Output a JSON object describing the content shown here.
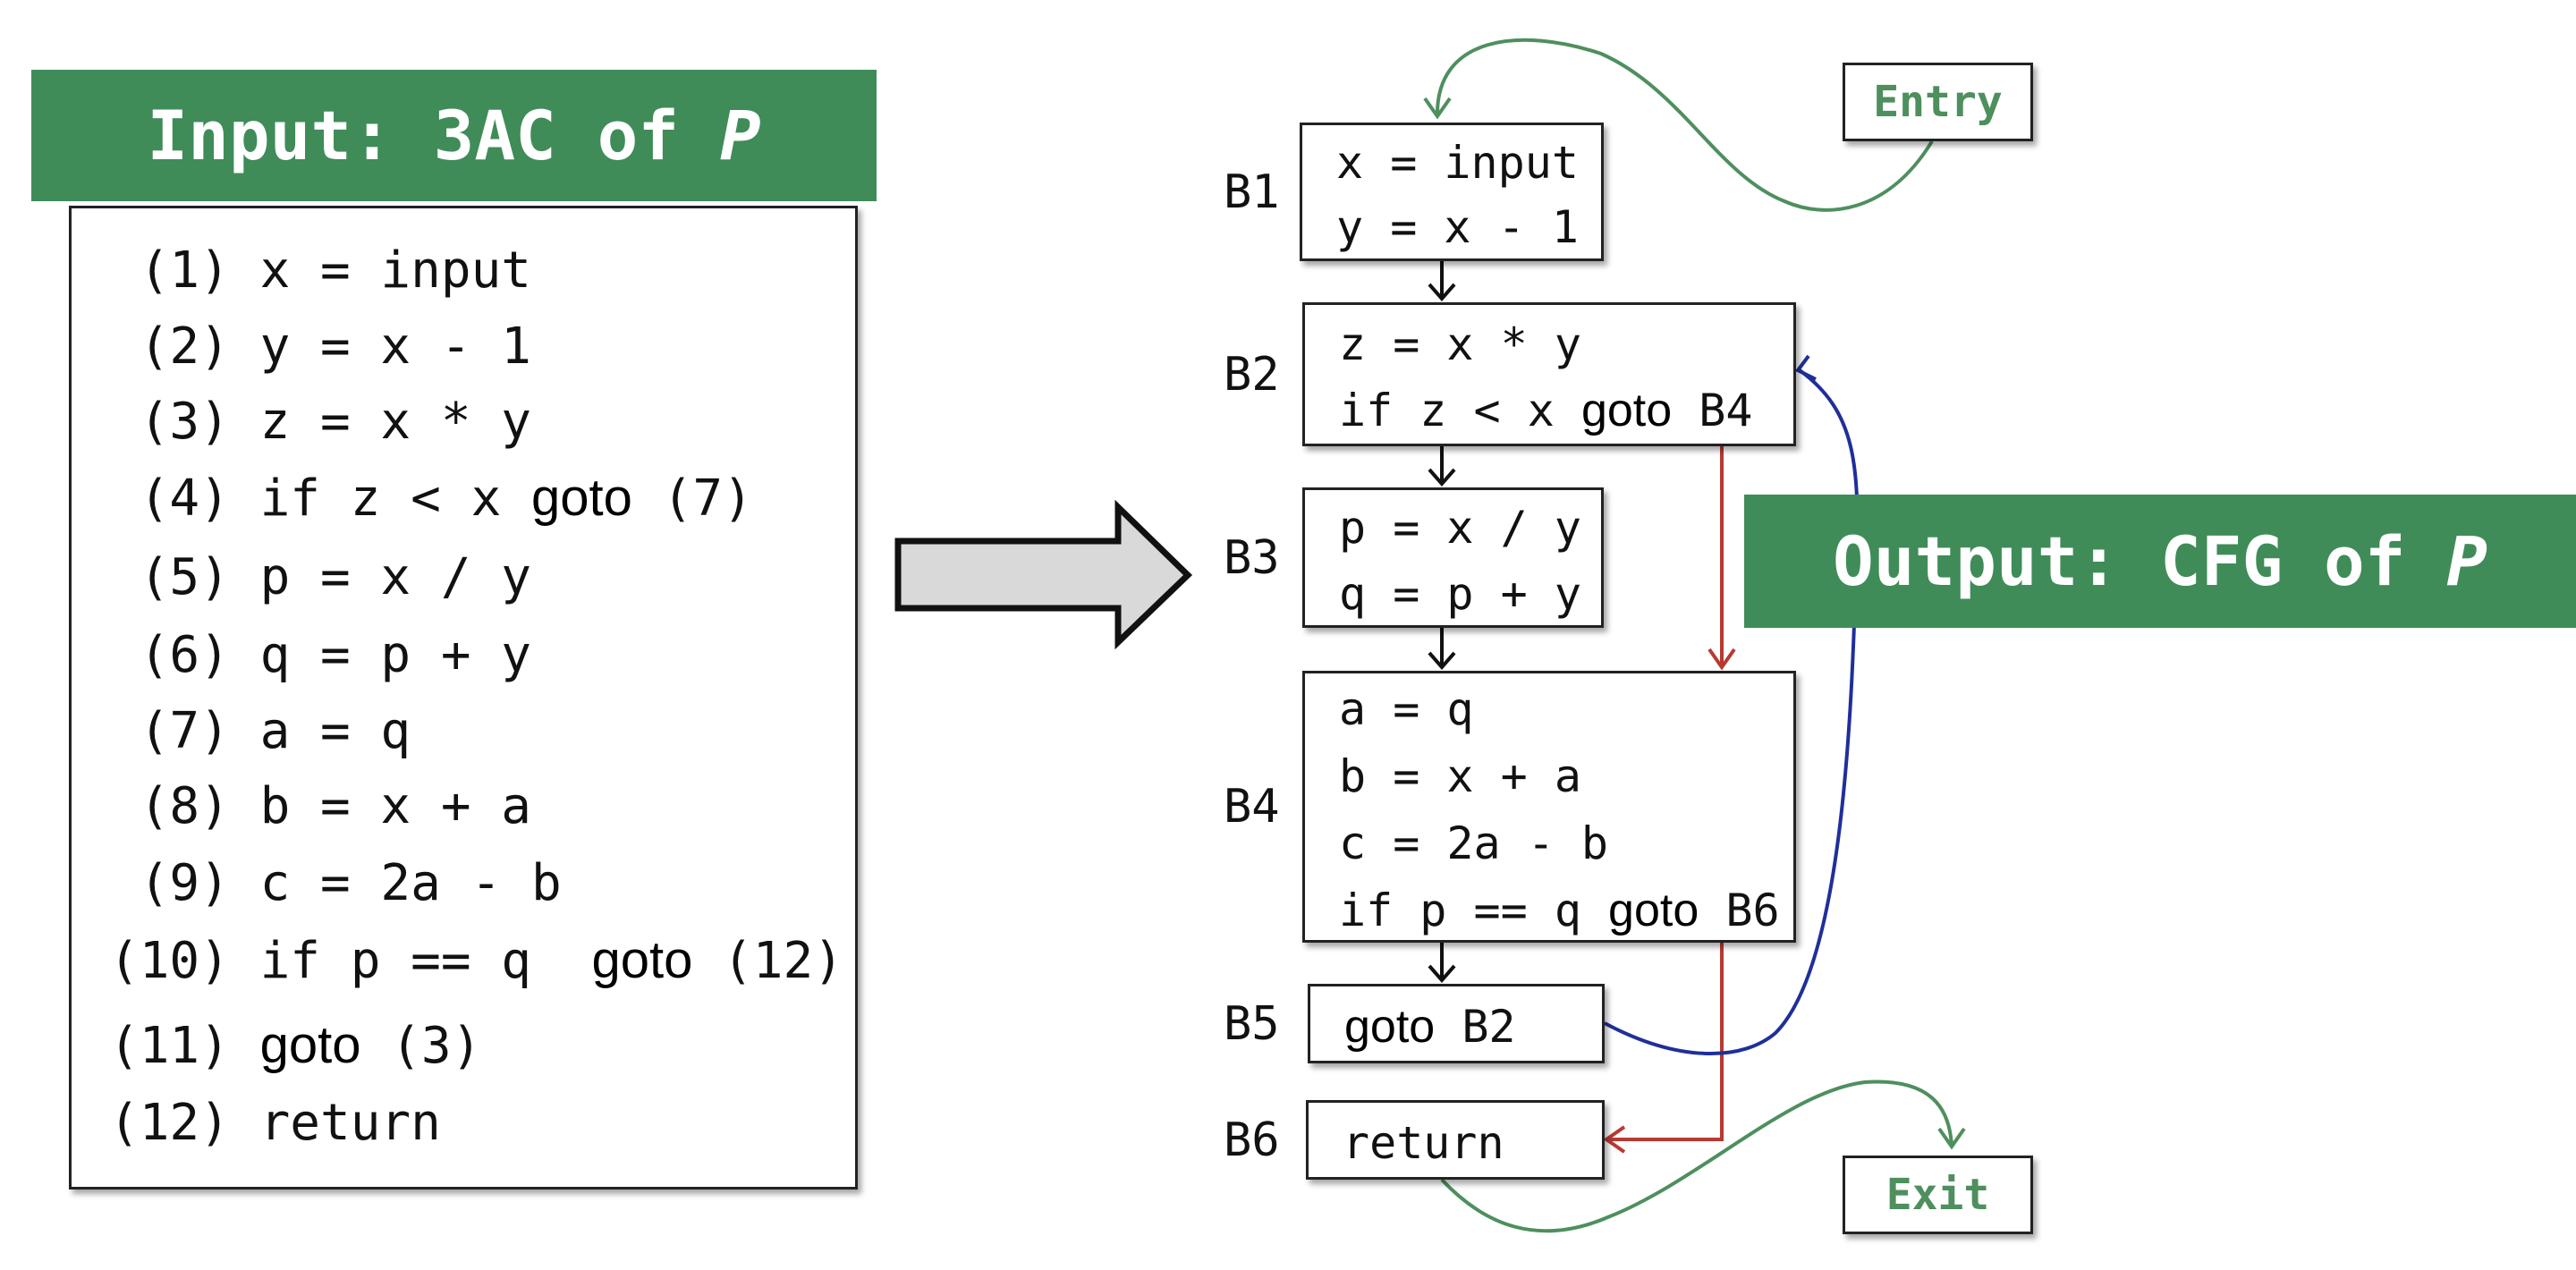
{
  "input": {
    "title_prefix": "Input: 3AC of ",
    "title_var": "P",
    "lines": [
      {
        "num": " (1)",
        "code": " x = input",
        "kw": "",
        "tail": ""
      },
      {
        "num": " (2)",
        "code": " y = x - 1",
        "kw": "",
        "tail": ""
      },
      {
        "num": " (3)",
        "code": " z = x * y",
        "kw": "",
        "tail": ""
      },
      {
        "num": " (4)",
        "code": " if z < x ",
        "kw": "goto",
        "tail": " (7)"
      },
      {
        "num": " (5)",
        "code": " p = x / y",
        "kw": "",
        "tail": ""
      },
      {
        "num": " (6)",
        "code": " q = p + y",
        "kw": "",
        "tail": ""
      },
      {
        "num": " (7)",
        "code": " a = q",
        "kw": "",
        "tail": ""
      },
      {
        "num": " (8)",
        "code": " b = x + a",
        "kw": "",
        "tail": ""
      },
      {
        "num": " (9)",
        "code": " c = 2a - b",
        "kw": "",
        "tail": ""
      },
      {
        "num": "(10)",
        "code": " if p == q  ",
        "kw": "goto",
        "tail": " (12)"
      },
      {
        "num": "(11)",
        "code": " ",
        "kw": "goto",
        "tail": " (3)"
      },
      {
        "num": "(12)",
        "code": " return",
        "kw": "",
        "tail": ""
      }
    ]
  },
  "output": {
    "title_prefix": "Output: CFG of ",
    "title_var": "P",
    "entry_label": "Entry",
    "exit_label": "Exit",
    "blocks": [
      {
        "id": "B1",
        "lines": [
          {
            "code": "x = input",
            "kw": "",
            "tail": ""
          },
          {
            "code": "y = x - 1",
            "kw": "",
            "tail": ""
          }
        ]
      },
      {
        "id": "B2",
        "lines": [
          {
            "code": "z = x * y",
            "kw": "",
            "tail": ""
          },
          {
            "code": "if z < x ",
            "kw": "goto",
            "tail": " B4"
          }
        ]
      },
      {
        "id": "B3",
        "lines": [
          {
            "code": "p = x / y",
            "kw": "",
            "tail": ""
          },
          {
            "code": "q = p + y",
            "kw": "",
            "tail": ""
          }
        ]
      },
      {
        "id": "B4",
        "lines": [
          {
            "code": "a = q",
            "kw": "",
            "tail": ""
          },
          {
            "code": "b = x + a",
            "kw": "",
            "tail": ""
          },
          {
            "code": "c = 2a - b",
            "kw": "",
            "tail": ""
          },
          {
            "code": "if p == q ",
            "kw": "goto",
            "tail": " B6"
          }
        ]
      },
      {
        "id": "B5",
        "lines": [
          {
            "code": "",
            "kw": "goto",
            "tail": " B2"
          }
        ]
      },
      {
        "id": "B6",
        "lines": [
          {
            "code": "return",
            "kw": "",
            "tail": ""
          }
        ]
      }
    ],
    "edges": [
      {
        "from": "Entry",
        "to": "B1",
        "kind": "entry"
      },
      {
        "from": "B1",
        "to": "B2",
        "kind": "fallthrough"
      },
      {
        "from": "B2",
        "to": "B3",
        "kind": "fallthrough"
      },
      {
        "from": "B2",
        "to": "B4",
        "kind": "jump"
      },
      {
        "from": "B3",
        "to": "B4",
        "kind": "fallthrough"
      },
      {
        "from": "B4",
        "to": "B5",
        "kind": "fallthrough"
      },
      {
        "from": "B4",
        "to": "B6",
        "kind": "jump"
      },
      {
        "from": "B5",
        "to": "B2",
        "kind": "back-edge"
      },
      {
        "from": "B6",
        "to": "Exit",
        "kind": "exit"
      }
    ]
  },
  "colors": {
    "header_green": "#3f8c59",
    "terminal_green": "#4e8f5e",
    "jump_red": "#b73a32",
    "back_edge_blue": "#1f2f9a",
    "arrow_fill": "#d9d9d9"
  }
}
